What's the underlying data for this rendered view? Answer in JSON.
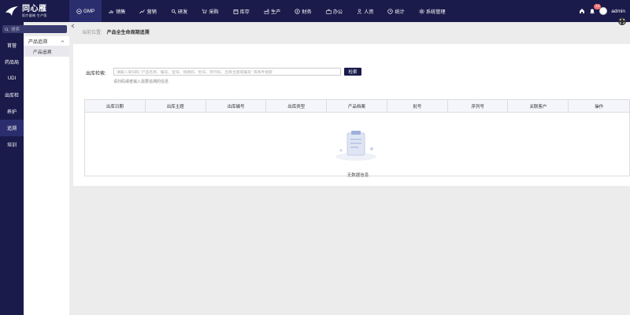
{
  "app": {
    "logo_name": "同心雁",
    "logo_sub": "医疗器械·生产版"
  },
  "topnav": {
    "items": [
      {
        "label": "GMP",
        "icon": "gmp-icon",
        "active": true
      },
      {
        "label": "销售",
        "icon": "bar-chart-icon"
      },
      {
        "label": "营销",
        "icon": "trend-icon"
      },
      {
        "label": "研发",
        "icon": "research-icon"
      },
      {
        "label": "采购",
        "icon": "cart-icon"
      },
      {
        "label": "库存",
        "icon": "inventory-icon"
      },
      {
        "label": "生产",
        "icon": "factory-icon"
      },
      {
        "label": "财务",
        "icon": "finance-icon"
      },
      {
        "label": "办公",
        "icon": "briefcase-icon"
      },
      {
        "label": "人资",
        "icon": "person-icon"
      },
      {
        "label": "统计",
        "icon": "clock-icon"
      },
      {
        "label": "系统管理",
        "icon": "gear-icon"
      }
    ],
    "notify_count": "14",
    "username": "admin"
  },
  "search": {
    "placeholder": "搜索"
  },
  "sidebar": {
    "items": [
      "首营",
      "药品局",
      "UDI",
      "出库检",
      "养护",
      "追溯",
      "培训"
    ],
    "active_index": 5
  },
  "submenu": {
    "group_label": "产品追溯",
    "item_label": "产品追溯"
  },
  "breadcrumb": {
    "label": "当前位置:",
    "current": "产品全生命周期追溯"
  },
  "form": {
    "label": "出库检索:",
    "placeholder": "请输入或扫码 \"产品名称、编号、型号、规格码、批号、序列号、出库主题或编号\" 等条件搜索",
    "button": "检索",
    "hint": "请扫码或者输入需要追溯的信息"
  },
  "table": {
    "columns": [
      "出库日期",
      "出库主题",
      "出库编号",
      "出库类型",
      "产品档案",
      "批号",
      "序列号",
      "关联客户",
      "操作"
    ],
    "empty_text": "无数据信息"
  },
  "colors": {
    "nav_bg": "#1a1b4b",
    "nav_active": "#2b2e6e",
    "page_bg": "#ececec"
  }
}
